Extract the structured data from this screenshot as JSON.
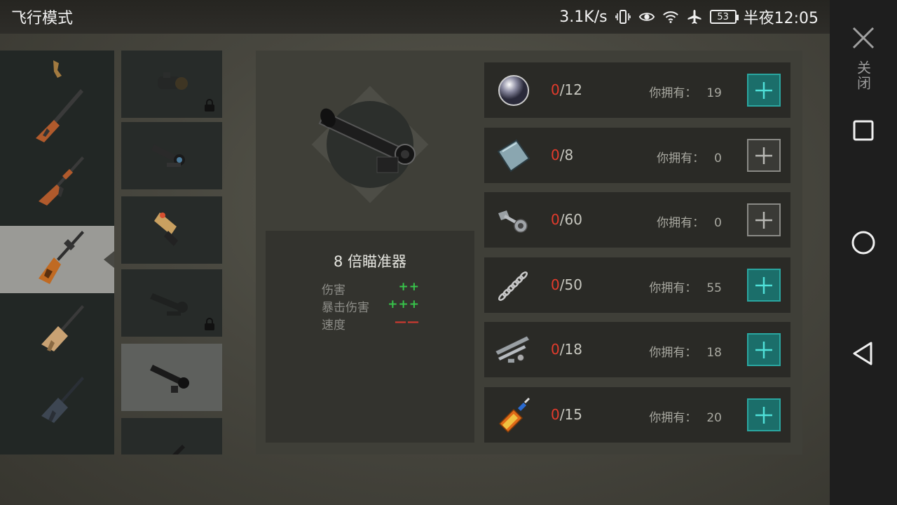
{
  "status_bar": {
    "mode": "飞行模式",
    "net_speed": "3.1K/s",
    "battery": "53",
    "time": "半夜12:05",
    "icons": [
      "vibrate-icon",
      "eye-icon",
      "wifi-icon",
      "airplane-icon",
      "battery-icon"
    ]
  },
  "nav_bar": {
    "close_label": "关闭",
    "icons": [
      "close-icon",
      "recent-apps-icon",
      "home-icon",
      "back-icon"
    ]
  },
  "weapons": [
    "pistol",
    "lever-rifle",
    "ak-rifle",
    "svd-rifle",
    "scar-rifle",
    "m4-rifle"
  ],
  "selected_weapon": "svd-rifle",
  "scopes": [
    {
      "icon": "red-dot-scope-icon",
      "locked": true
    },
    {
      "icon": "acog-scope-icon",
      "locked": false
    },
    {
      "icon": "holo-sight-icon",
      "locked": false
    },
    {
      "icon": "rifle-scope-icon",
      "locked": true
    },
    {
      "icon": "8x-scope-icon",
      "locked": false,
      "selected": true
    },
    {
      "icon": "grip-icon",
      "locked": false
    }
  ],
  "item": {
    "name": "8 倍瞄准器",
    "stats": [
      {
        "label": "伤害",
        "value": "++",
        "trend": "up"
      },
      {
        "label": "暴击伤害",
        "value": "+++",
        "trend": "up"
      },
      {
        "label": "速度",
        "value": "——",
        "trend": "down"
      }
    ]
  },
  "own_label": "你拥有：",
  "materials": [
    {
      "icon": "lens-icon",
      "have": "0",
      "need": "/12",
      "own": "19",
      "can_add": true
    },
    {
      "icon": "metal-plate-icon",
      "have": "0",
      "need": "/8",
      "own": "0",
      "can_add": false
    },
    {
      "icon": "bolt-nut-icon",
      "have": "0",
      "need": "/60",
      "own": "0",
      "can_add": false
    },
    {
      "icon": "spring-icon",
      "have": "0",
      "need": "/50",
      "own": "55",
      "can_add": true
    },
    {
      "icon": "gun-parts-icon",
      "have": "0",
      "need": "/18",
      "own": "18",
      "can_add": true
    },
    {
      "icon": "glue-icon",
      "have": "0",
      "need": "/15",
      "own": "20",
      "can_add": true
    }
  ]
}
